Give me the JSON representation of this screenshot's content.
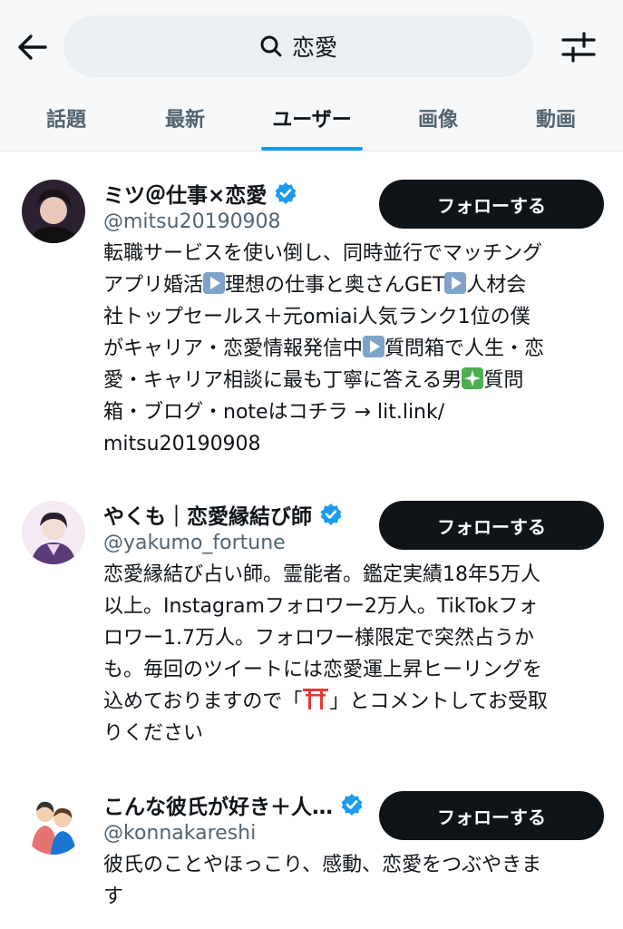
{
  "search": {
    "query": "恋愛"
  },
  "tabs": [
    {
      "label": "話題"
    },
    {
      "label": "最新"
    },
    {
      "label": "ユーザー"
    },
    {
      "label": "画像"
    },
    {
      "label": "動画"
    }
  ],
  "users": [
    {
      "name": "ミツ＠仕事×恋愛",
      "handle": "@mitsu20190908",
      "follow_label": "フォローする",
      "bio": [
        [
          "転職サービスを使い倒し、同時並行でマッチング"
        ],
        [
          "アプリ婚活",
          "▶",
          "理想の仕事と奥さんGET",
          "▶",
          "人材会"
        ],
        [
          "社トップセールス＋元omiai人気ランク1位の僕"
        ],
        [
          "がキャリア・恋愛情報発信中",
          "▶",
          "質問箱で人生・恋"
        ],
        [
          "愛・キャリア相談に最も丁寧に答える男",
          "✦",
          "質問"
        ],
        [
          "箱・ブログ・noteはコチラ → lit.link/"
        ],
        [
          "mitsu20190908"
        ]
      ]
    },
    {
      "name": "やくも｜恋愛縁結び師",
      "handle": "@yakumo_fortune",
      "follow_label": "フォローする",
      "bio": [
        [
          "恋愛縁結び占い師。霊能者。鑑定実績18年5万人"
        ],
        [
          "以上。Instagramフォロワー2万人。TikTokフォ"
        ],
        [
          "ロワー1.7万人。フォロワー様限定で突然占うか"
        ],
        [
          "も。毎回のツイートには恋愛運上昇ヒーリングを"
        ],
        [
          "込めておりますので「",
          "⛩",
          "」とコメントしてお受取"
        ],
        [
          "りください"
        ]
      ]
    },
    {
      "name": "こんな彼氏が好き＋人…",
      "handle": "@konnakareshi",
      "follow_label": "フォローする",
      "bio": [
        [
          "彼氏のことやほっこり、感動、恋愛をつぶやきま"
        ],
        [
          "す"
        ]
      ]
    }
  ],
  "icons": {
    "back": "back-arrow-icon",
    "search": "search-icon",
    "filter": "filter-sliders-icon",
    "verified": "verified-badge-icon",
    "play": "play-button-emoji",
    "sparkle": "sparkles-emoji",
    "shrine": "torii-gate-emoji"
  },
  "colors": {
    "accent": "#1d9bf0",
    "button": "#0f1419",
    "muted": "#536471"
  }
}
